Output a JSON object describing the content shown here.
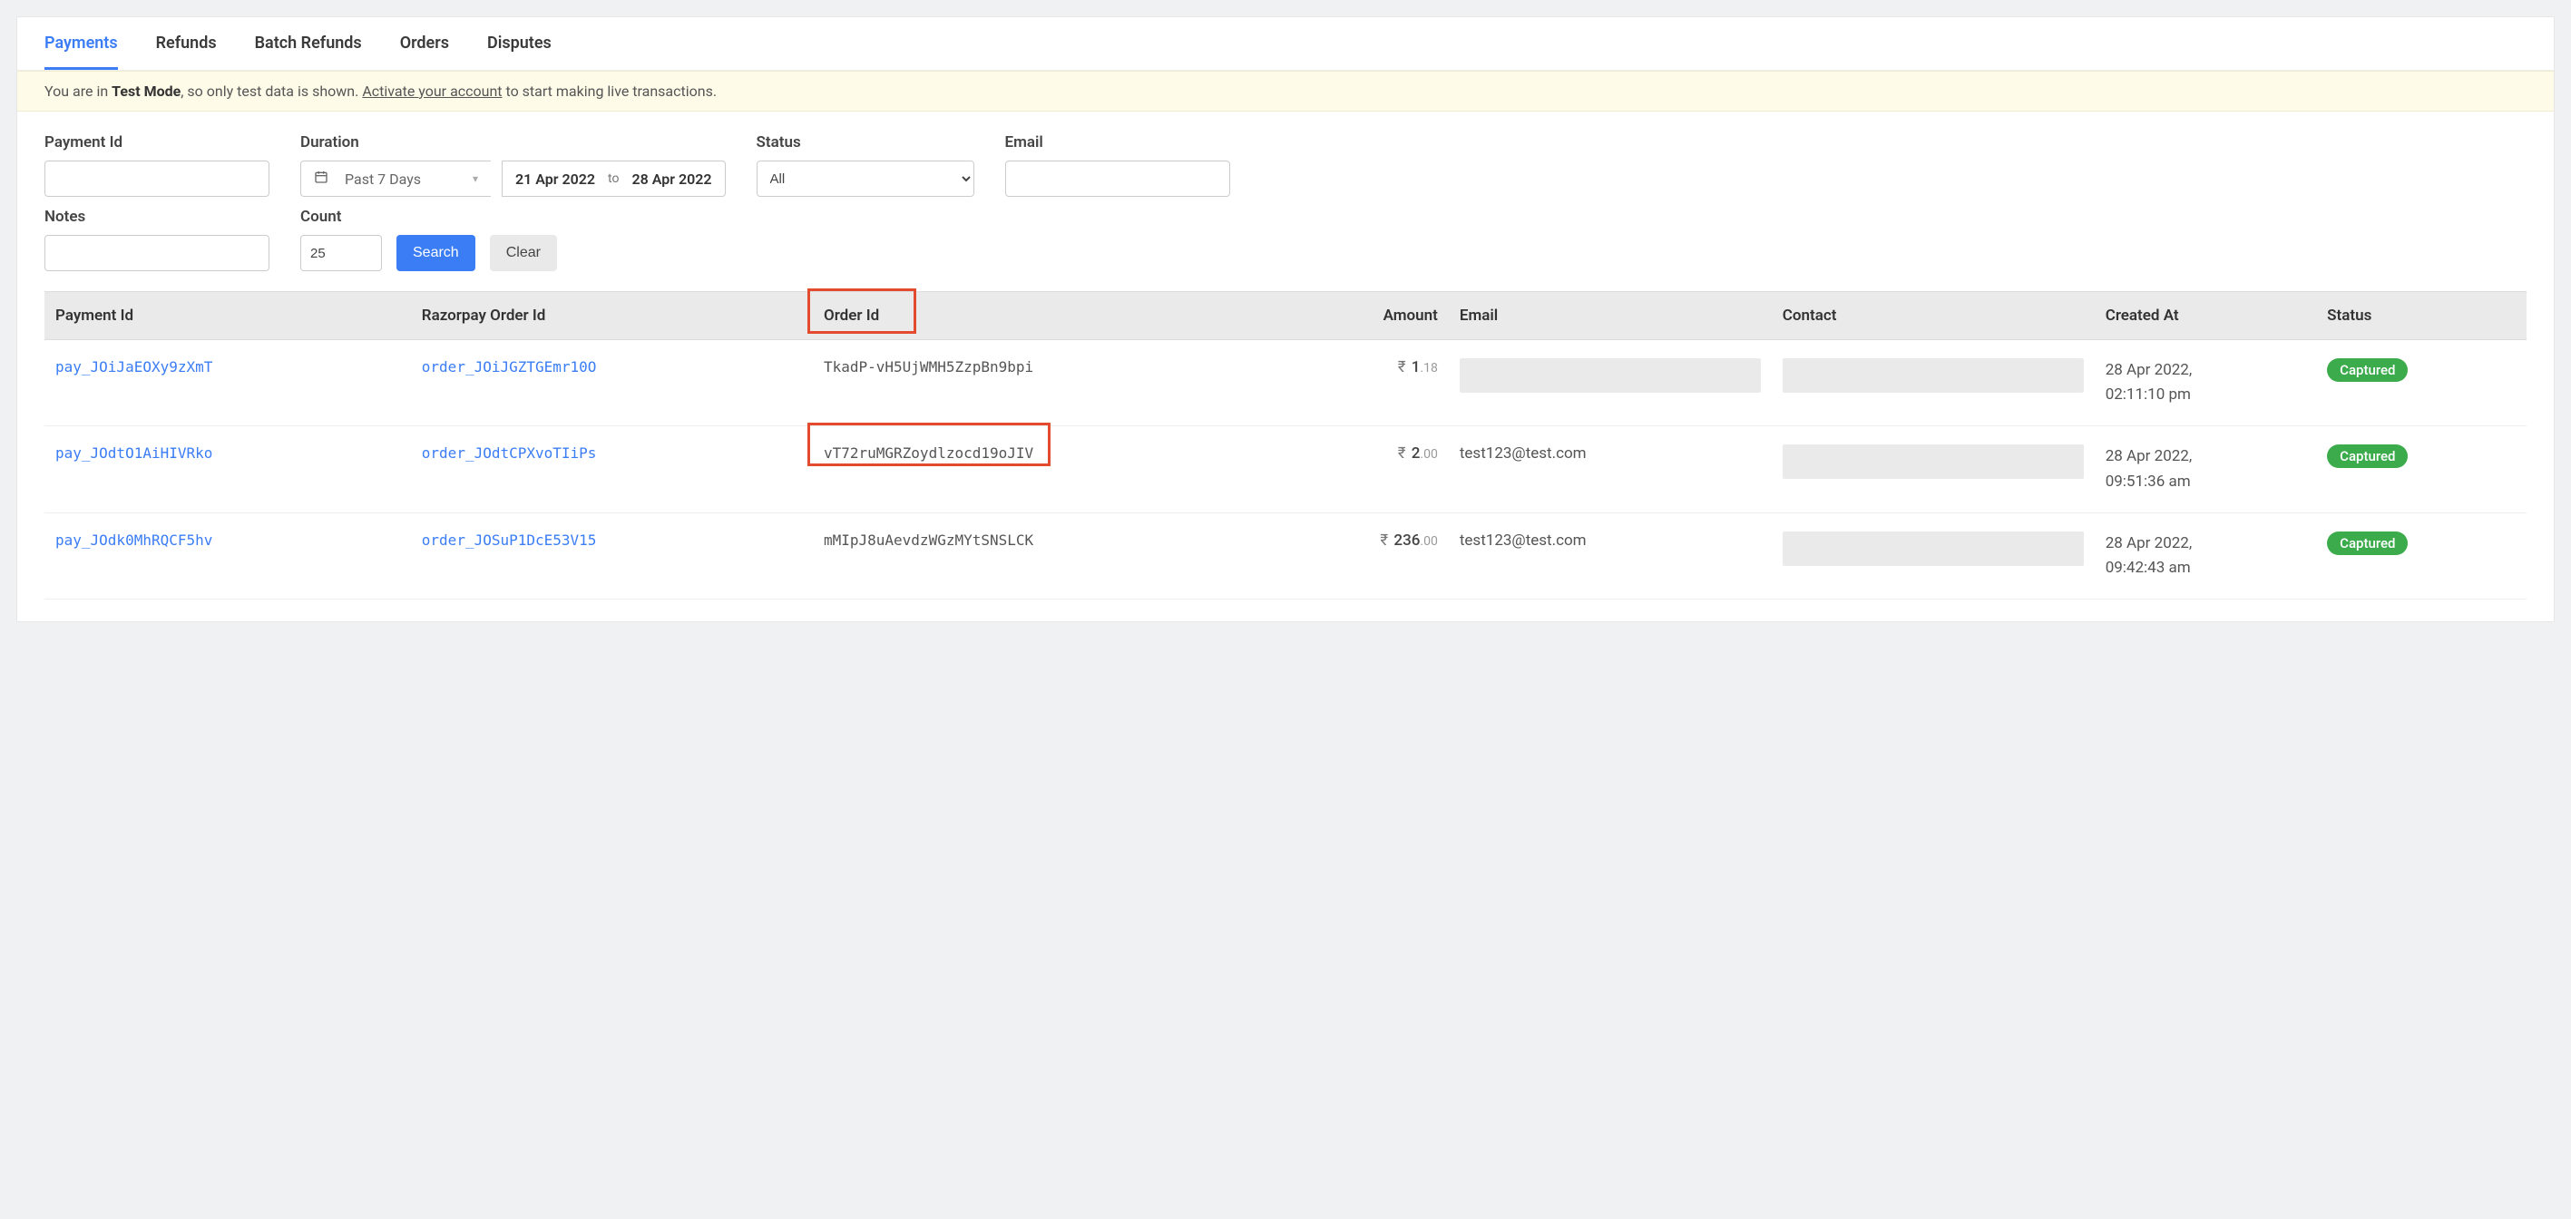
{
  "tabs": {
    "items": [
      {
        "label": "Payments",
        "active": true
      },
      {
        "label": "Refunds",
        "active": false
      },
      {
        "label": "Batch Refunds",
        "active": false
      },
      {
        "label": "Orders",
        "active": false
      },
      {
        "label": "Disputes",
        "active": false
      }
    ]
  },
  "notice": {
    "prefix": "You are in ",
    "mode": "Test Mode",
    "mid": ", so only test data is shown. ",
    "link": "Activate your account",
    "suffix": " to start making live transactions."
  },
  "filters": {
    "payment_id": {
      "label": "Payment Id",
      "value": ""
    },
    "duration": {
      "label": "Duration",
      "preset": "Past 7 Days",
      "from": "21 Apr 2022",
      "to_label": "to",
      "to": "28 Apr 2022"
    },
    "status": {
      "label": "Status",
      "value": "All",
      "options": [
        "All"
      ]
    },
    "email": {
      "label": "Email",
      "value": ""
    },
    "notes": {
      "label": "Notes",
      "value": ""
    },
    "count": {
      "label": "Count",
      "value": "25"
    },
    "buttons": {
      "search": "Search",
      "clear": "Clear"
    }
  },
  "columns": [
    "Payment Id",
    "Razorpay Order Id",
    "Order Id",
    "Amount",
    "Email",
    "Contact",
    "Created At",
    "Status"
  ],
  "rows": [
    {
      "payment_id": "pay_JOiJaEOXy9zXmT",
      "rzp_order_id": "order_JOiJGZTGEmr10O",
      "order_id": "TkadP-vH5UjWMH5ZzpBn9bpi",
      "amount_whole": "1",
      "amount_dec": ".18",
      "currency_glyph": "₹",
      "email": "",
      "email_hidden": true,
      "contact_hidden": true,
      "created_at": "28 Apr 2022, 02:11:10 pm",
      "status": "Captured",
      "highlight": false
    },
    {
      "payment_id": "pay_JOdtO1AiHIVRko",
      "rzp_order_id": "order_JOdtCPXvoTIiPs",
      "order_id": "vT72ruMGRZoydlzocd19oJIV",
      "amount_whole": "2",
      "amount_dec": ".00",
      "currency_glyph": "₹",
      "email": "test123@test.com",
      "email_hidden": false,
      "contact_hidden": true,
      "created_at": "28 Apr 2022, 09:51:36 am",
      "status": "Captured",
      "highlight": true
    },
    {
      "payment_id": "pay_JOdk0MhRQCF5hv",
      "rzp_order_id": "order_JOSuP1DcE53V15",
      "order_id": "mMIpJ8uAevdzWGzMYtSNSLCK",
      "amount_whole": "236",
      "amount_dec": ".00",
      "currency_glyph": "₹",
      "email": "test123@test.com",
      "email_hidden": false,
      "contact_hidden": true,
      "created_at": "28 Apr 2022, 09:42:43 am",
      "status": "Captured",
      "highlight": false
    }
  ]
}
